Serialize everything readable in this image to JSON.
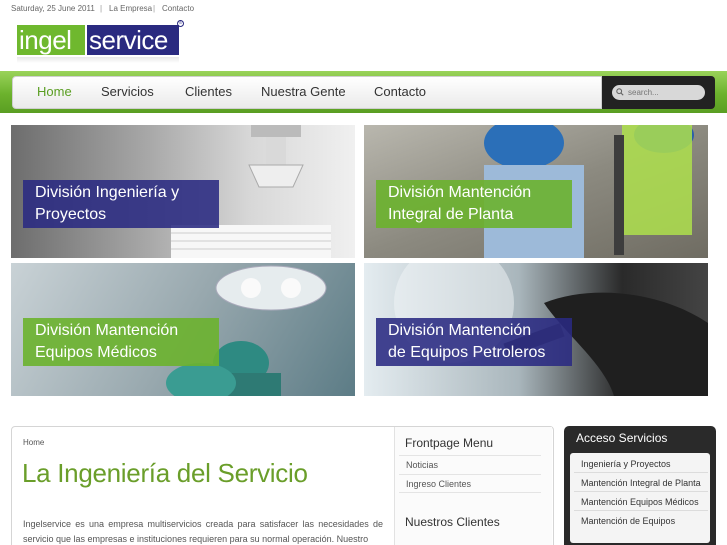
{
  "topbar": {
    "date": "Saturday, 25 June 2011",
    "separator": "|",
    "links": [
      "La Empresa",
      "Contacto"
    ]
  },
  "logo": {
    "part1": "ingel",
    "part2": "service",
    "mark": "®",
    "colors": {
      "green": "#6fb82e",
      "navy": "#2a2a80"
    }
  },
  "nav": {
    "items": [
      "Home",
      "Servicios",
      "Clientes",
      "Nuestra Gente",
      "Contacto"
    ],
    "active": "Home",
    "accent": "#6cb22d"
  },
  "search": {
    "placeholder": "search..."
  },
  "banners": [
    {
      "label": "División Ingeniería y\nProyectos"
    },
    {
      "label": "División Mantención\nIntegral de Planta"
    },
    {
      "label": "División Mantención\nEquipos Médicos"
    },
    {
      "label": "División Mantención\nde Equipos Petroleros"
    }
  ],
  "main": {
    "breadcrumb": "Home",
    "title": "La Ingeniería del Servicio",
    "body": "Ingelservice es una empresa multiservicios creada para satisfacer las necesidades de servicio que las empresas e instituciones requieren para su normal operación. Nuestro"
  },
  "sidebar": {
    "frontpage_title": "Frontpage Menu",
    "frontpage_items": [
      "Noticias",
      "Ingreso Clientes"
    ],
    "clients_title": "Nuestros Clientes"
  },
  "access": {
    "title": "Acceso Servicios",
    "items": [
      "Ingeniería y Proyectos",
      "Mantención Integral de Planta",
      "Mantención Equipos Médicos",
      "Mantención de Equipos"
    ]
  }
}
